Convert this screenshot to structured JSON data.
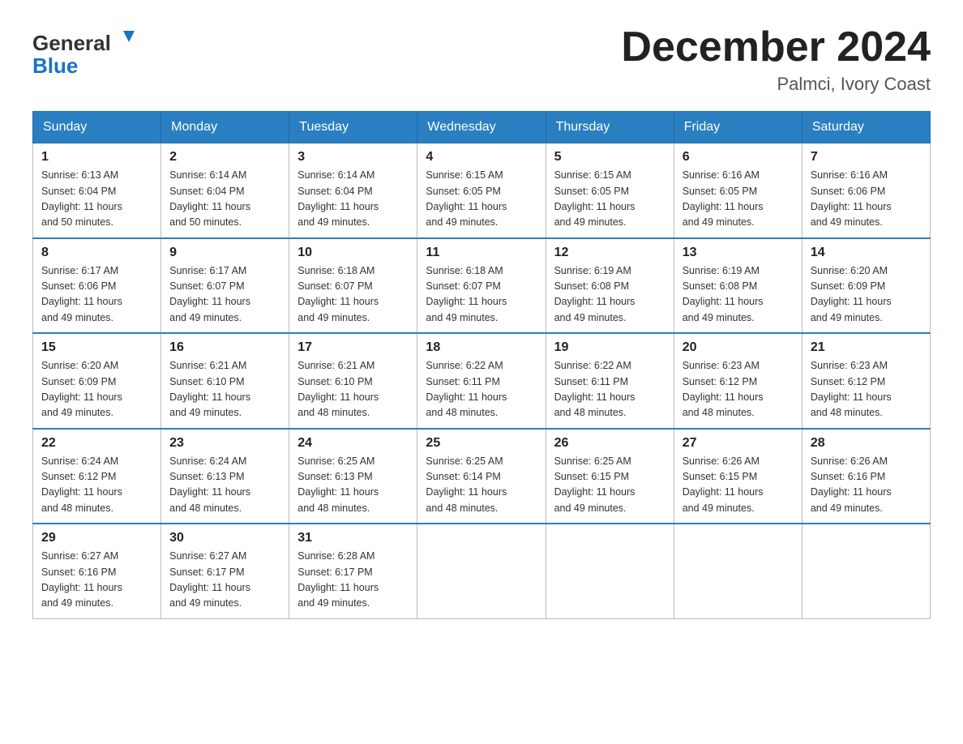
{
  "logo": {
    "text_general": "General",
    "text_blue": "Blue",
    "alt": "GeneralBlue logo"
  },
  "title": "December 2024",
  "subtitle": "Palmci, Ivory Coast",
  "days_of_week": [
    "Sunday",
    "Monday",
    "Tuesday",
    "Wednesday",
    "Thursday",
    "Friday",
    "Saturday"
  ],
  "weeks": [
    [
      {
        "day": "1",
        "sunrise": "6:13 AM",
        "sunset": "6:04 PM",
        "daylight": "11 hours and 50 minutes."
      },
      {
        "day": "2",
        "sunrise": "6:14 AM",
        "sunset": "6:04 PM",
        "daylight": "11 hours and 50 minutes."
      },
      {
        "day": "3",
        "sunrise": "6:14 AM",
        "sunset": "6:04 PM",
        "daylight": "11 hours and 49 minutes."
      },
      {
        "day": "4",
        "sunrise": "6:15 AM",
        "sunset": "6:05 PM",
        "daylight": "11 hours and 49 minutes."
      },
      {
        "day": "5",
        "sunrise": "6:15 AM",
        "sunset": "6:05 PM",
        "daylight": "11 hours and 49 minutes."
      },
      {
        "day": "6",
        "sunrise": "6:16 AM",
        "sunset": "6:05 PM",
        "daylight": "11 hours and 49 minutes."
      },
      {
        "day": "7",
        "sunrise": "6:16 AM",
        "sunset": "6:06 PM",
        "daylight": "11 hours and 49 minutes."
      }
    ],
    [
      {
        "day": "8",
        "sunrise": "6:17 AM",
        "sunset": "6:06 PM",
        "daylight": "11 hours and 49 minutes."
      },
      {
        "day": "9",
        "sunrise": "6:17 AM",
        "sunset": "6:07 PM",
        "daylight": "11 hours and 49 minutes."
      },
      {
        "day": "10",
        "sunrise": "6:18 AM",
        "sunset": "6:07 PM",
        "daylight": "11 hours and 49 minutes."
      },
      {
        "day": "11",
        "sunrise": "6:18 AM",
        "sunset": "6:07 PM",
        "daylight": "11 hours and 49 minutes."
      },
      {
        "day": "12",
        "sunrise": "6:19 AM",
        "sunset": "6:08 PM",
        "daylight": "11 hours and 49 minutes."
      },
      {
        "day": "13",
        "sunrise": "6:19 AM",
        "sunset": "6:08 PM",
        "daylight": "11 hours and 49 minutes."
      },
      {
        "day": "14",
        "sunrise": "6:20 AM",
        "sunset": "6:09 PM",
        "daylight": "11 hours and 49 minutes."
      }
    ],
    [
      {
        "day": "15",
        "sunrise": "6:20 AM",
        "sunset": "6:09 PM",
        "daylight": "11 hours and 49 minutes."
      },
      {
        "day": "16",
        "sunrise": "6:21 AM",
        "sunset": "6:10 PM",
        "daylight": "11 hours and 49 minutes."
      },
      {
        "day": "17",
        "sunrise": "6:21 AM",
        "sunset": "6:10 PM",
        "daylight": "11 hours and 48 minutes."
      },
      {
        "day": "18",
        "sunrise": "6:22 AM",
        "sunset": "6:11 PM",
        "daylight": "11 hours and 48 minutes."
      },
      {
        "day": "19",
        "sunrise": "6:22 AM",
        "sunset": "6:11 PM",
        "daylight": "11 hours and 48 minutes."
      },
      {
        "day": "20",
        "sunrise": "6:23 AM",
        "sunset": "6:12 PM",
        "daylight": "11 hours and 48 minutes."
      },
      {
        "day": "21",
        "sunrise": "6:23 AM",
        "sunset": "6:12 PM",
        "daylight": "11 hours and 48 minutes."
      }
    ],
    [
      {
        "day": "22",
        "sunrise": "6:24 AM",
        "sunset": "6:12 PM",
        "daylight": "11 hours and 48 minutes."
      },
      {
        "day": "23",
        "sunrise": "6:24 AM",
        "sunset": "6:13 PM",
        "daylight": "11 hours and 48 minutes."
      },
      {
        "day": "24",
        "sunrise": "6:25 AM",
        "sunset": "6:13 PM",
        "daylight": "11 hours and 48 minutes."
      },
      {
        "day": "25",
        "sunrise": "6:25 AM",
        "sunset": "6:14 PM",
        "daylight": "11 hours and 48 minutes."
      },
      {
        "day": "26",
        "sunrise": "6:25 AM",
        "sunset": "6:15 PM",
        "daylight": "11 hours and 49 minutes."
      },
      {
        "day": "27",
        "sunrise": "6:26 AM",
        "sunset": "6:15 PM",
        "daylight": "11 hours and 49 minutes."
      },
      {
        "day": "28",
        "sunrise": "6:26 AM",
        "sunset": "6:16 PM",
        "daylight": "11 hours and 49 minutes."
      }
    ],
    [
      {
        "day": "29",
        "sunrise": "6:27 AM",
        "sunset": "6:16 PM",
        "daylight": "11 hours and 49 minutes."
      },
      {
        "day": "30",
        "sunrise": "6:27 AM",
        "sunset": "6:17 PM",
        "daylight": "11 hours and 49 minutes."
      },
      {
        "day": "31",
        "sunrise": "6:28 AM",
        "sunset": "6:17 PM",
        "daylight": "11 hours and 49 minutes."
      },
      null,
      null,
      null,
      null
    ]
  ],
  "labels": {
    "sunrise": "Sunrise:",
    "sunset": "Sunset:",
    "daylight": "Daylight:"
  }
}
